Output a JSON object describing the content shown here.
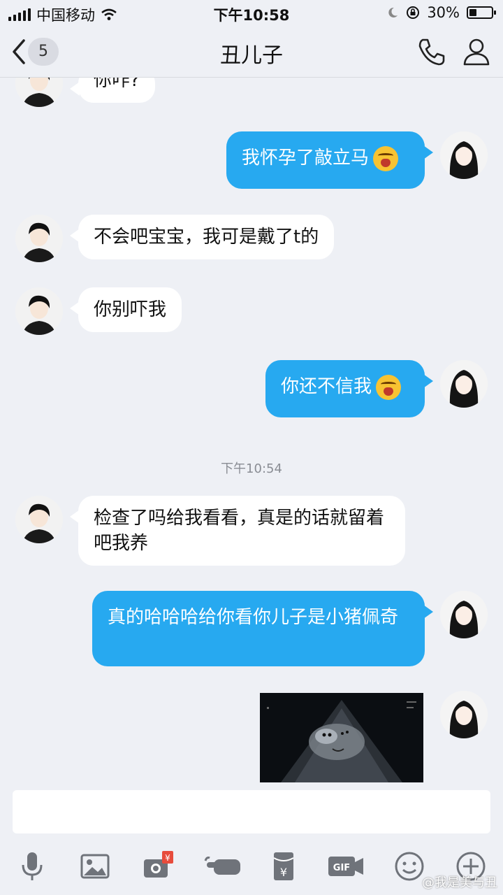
{
  "status_bar": {
    "carrier": "中国移动",
    "time": "下午10:58",
    "battery": "30%"
  },
  "nav": {
    "back_badge": "5",
    "title": "丑儿子"
  },
  "messages": [
    {
      "side": "in",
      "text": "你咋?"
    },
    {
      "side": "out",
      "text": "我怀孕了敲立马"
    },
    {
      "side": "in",
      "text": "不会吧宝宝，我可是戴了t的"
    },
    {
      "side": "in",
      "text": "你别吓我"
    },
    {
      "side": "out",
      "text": "你还不信我"
    },
    {
      "side": "in",
      "text": "检查了吗给我看看，真是的话就留着吧我养"
    },
    {
      "side": "out",
      "text": "真的哈哈哈给你看你儿子是小猪佩奇"
    }
  ],
  "timestamp": "下午10:54",
  "toolbar": {
    "gif_label": "GIF",
    "red_packet_label": "¥"
  },
  "watermark": "@我是美与丑"
}
